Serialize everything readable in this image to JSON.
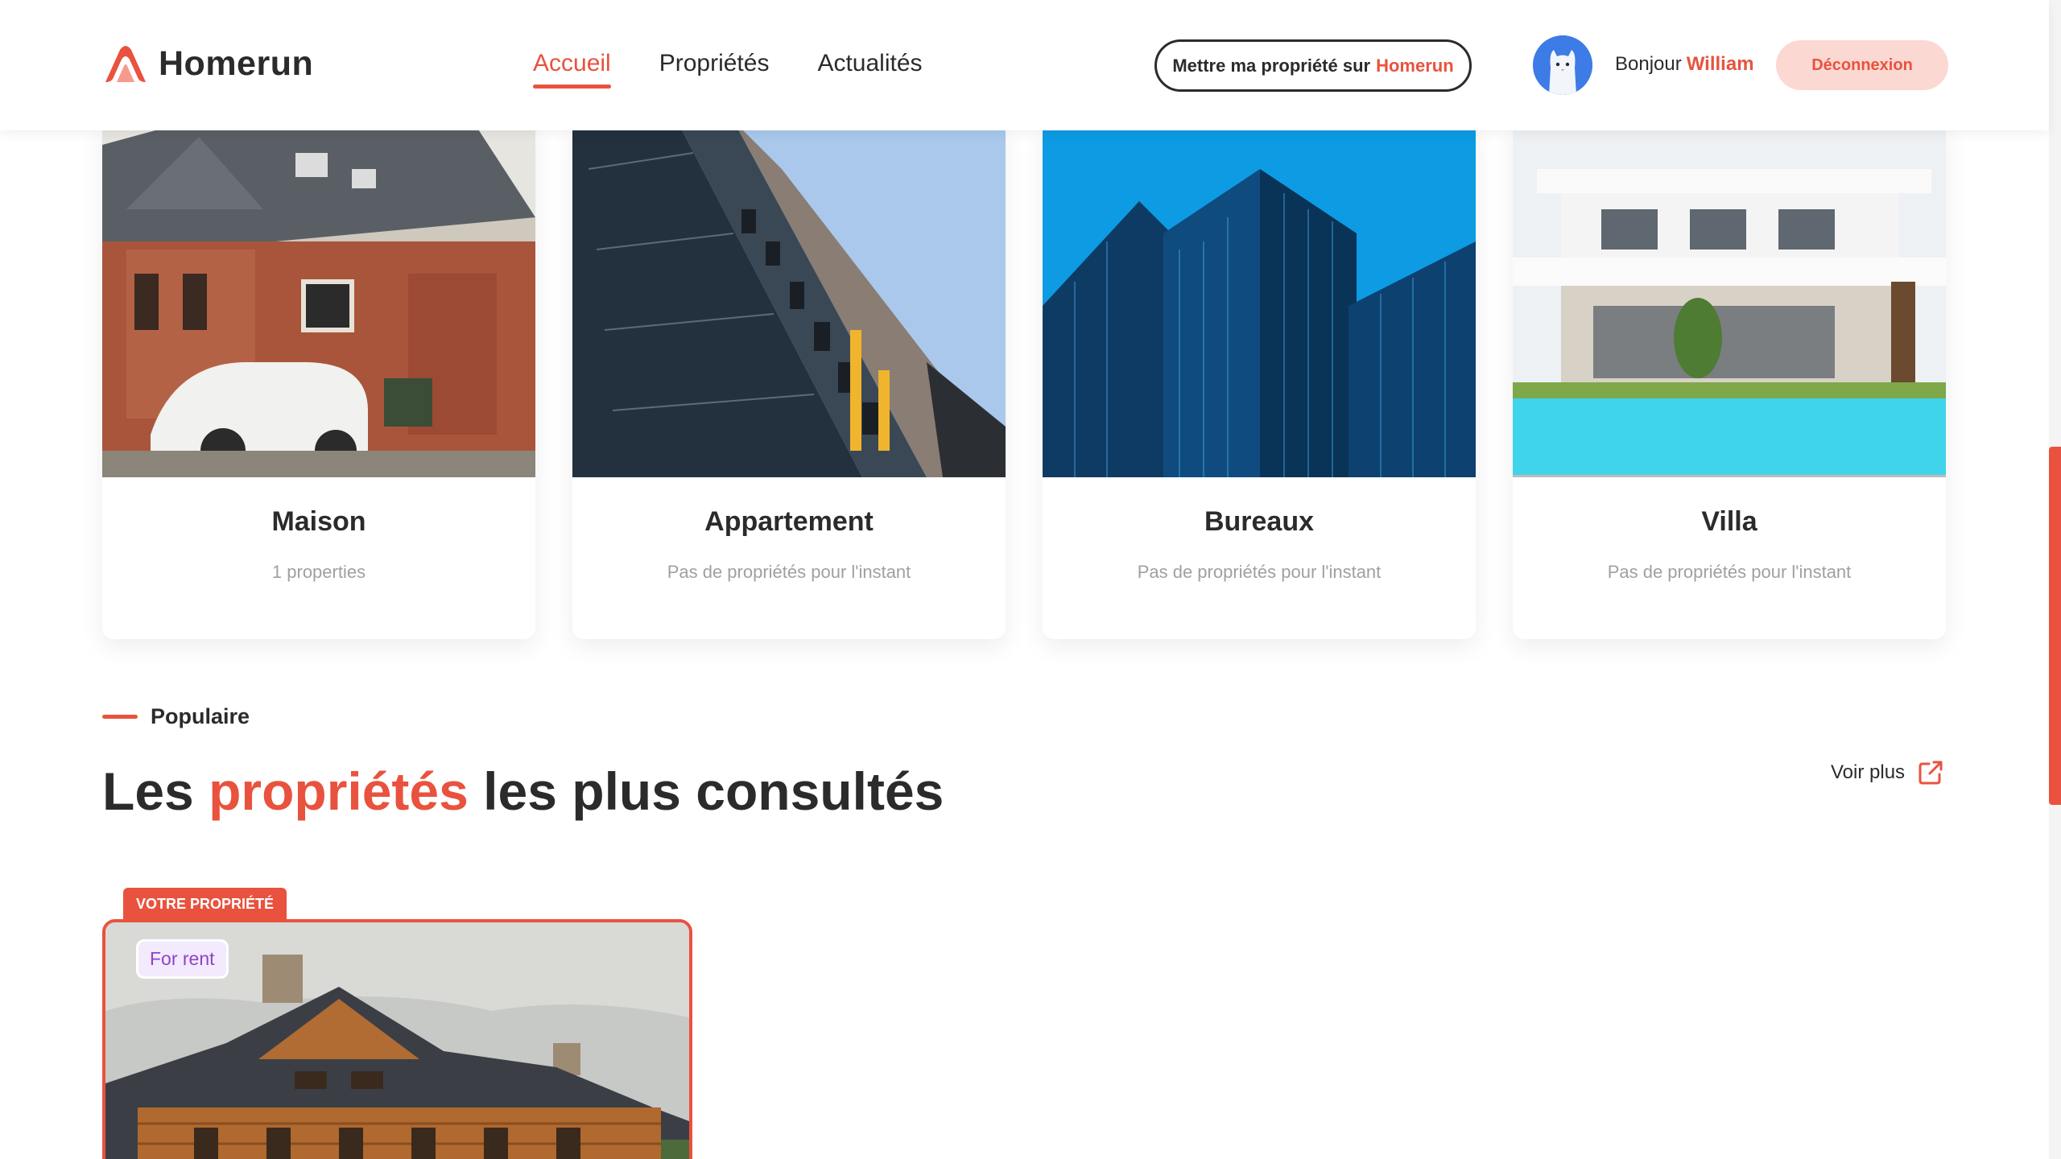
{
  "header": {
    "logo_text": "Homerun",
    "nav": [
      {
        "label": "Accueil",
        "active": true
      },
      {
        "label": "Propriétés",
        "active": false
      },
      {
        "label": "Actualités",
        "active": false
      }
    ],
    "cta_prefix": "Mettre ma propriété sur",
    "cta_brand": "Homerun",
    "greeting": "Bonjour",
    "user_name": "William",
    "logout_label": "Déconnexion"
  },
  "categories": [
    {
      "title": "Maison",
      "subtitle": "1 properties"
    },
    {
      "title": "Appartement",
      "subtitle": "Pas de propriétés pour l'instant"
    },
    {
      "title": "Bureaux",
      "subtitle": "Pas de propriétés pour l'instant"
    },
    {
      "title": "Villa",
      "subtitle": "Pas de propriétés pour l'instant"
    }
  ],
  "popular": {
    "tag": "Populaire",
    "title_start": "Les",
    "title_accent": "propriétés",
    "title_end": "les plus consultés",
    "voir_plus": "Voir plus"
  },
  "property": {
    "badge": "VOTRE PROPRIÉTÉ",
    "status": "For rent"
  },
  "colors": {
    "accent": "#e9523e",
    "logout_bg": "#fcd8d3",
    "rent_badge_text": "#8e44c9"
  }
}
